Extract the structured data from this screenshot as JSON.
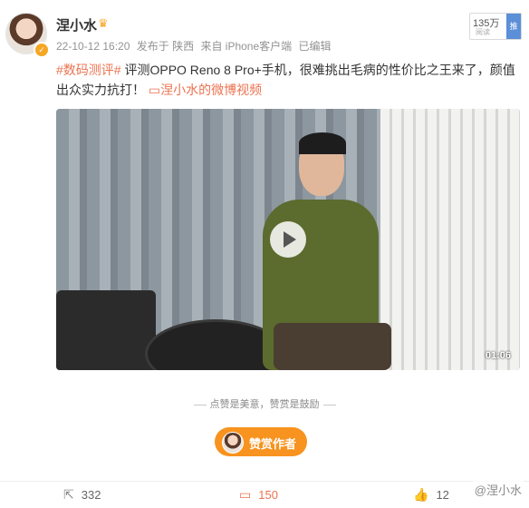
{
  "post": {
    "username": "涅小水",
    "crown_icon": "crown-icon",
    "meta": {
      "time": "22-10-12 16:20",
      "published_in": "发布于 陕西",
      "source": "来自 iPhone客户端",
      "edited": "已编辑"
    },
    "reads": {
      "count": "135万",
      "sub": "阅读",
      "promo": "推"
    },
    "hashtag": "#数码测评#",
    "body": " 评测OPPO Reno 8 Pro+手机，很难挑出毛病的性价比之王来了，颜值出众实力抗打！",
    "video_link": "涅小水的微博视频"
  },
  "video": {
    "duration": "01:06"
  },
  "reward": {
    "tip": "点赞是美意，赞赏是鼓励",
    "button_label": "赞赏作者"
  },
  "actions": {
    "share_count": "332",
    "comment_count": "150",
    "like_count": "12"
  },
  "watermark": "@涅小水"
}
